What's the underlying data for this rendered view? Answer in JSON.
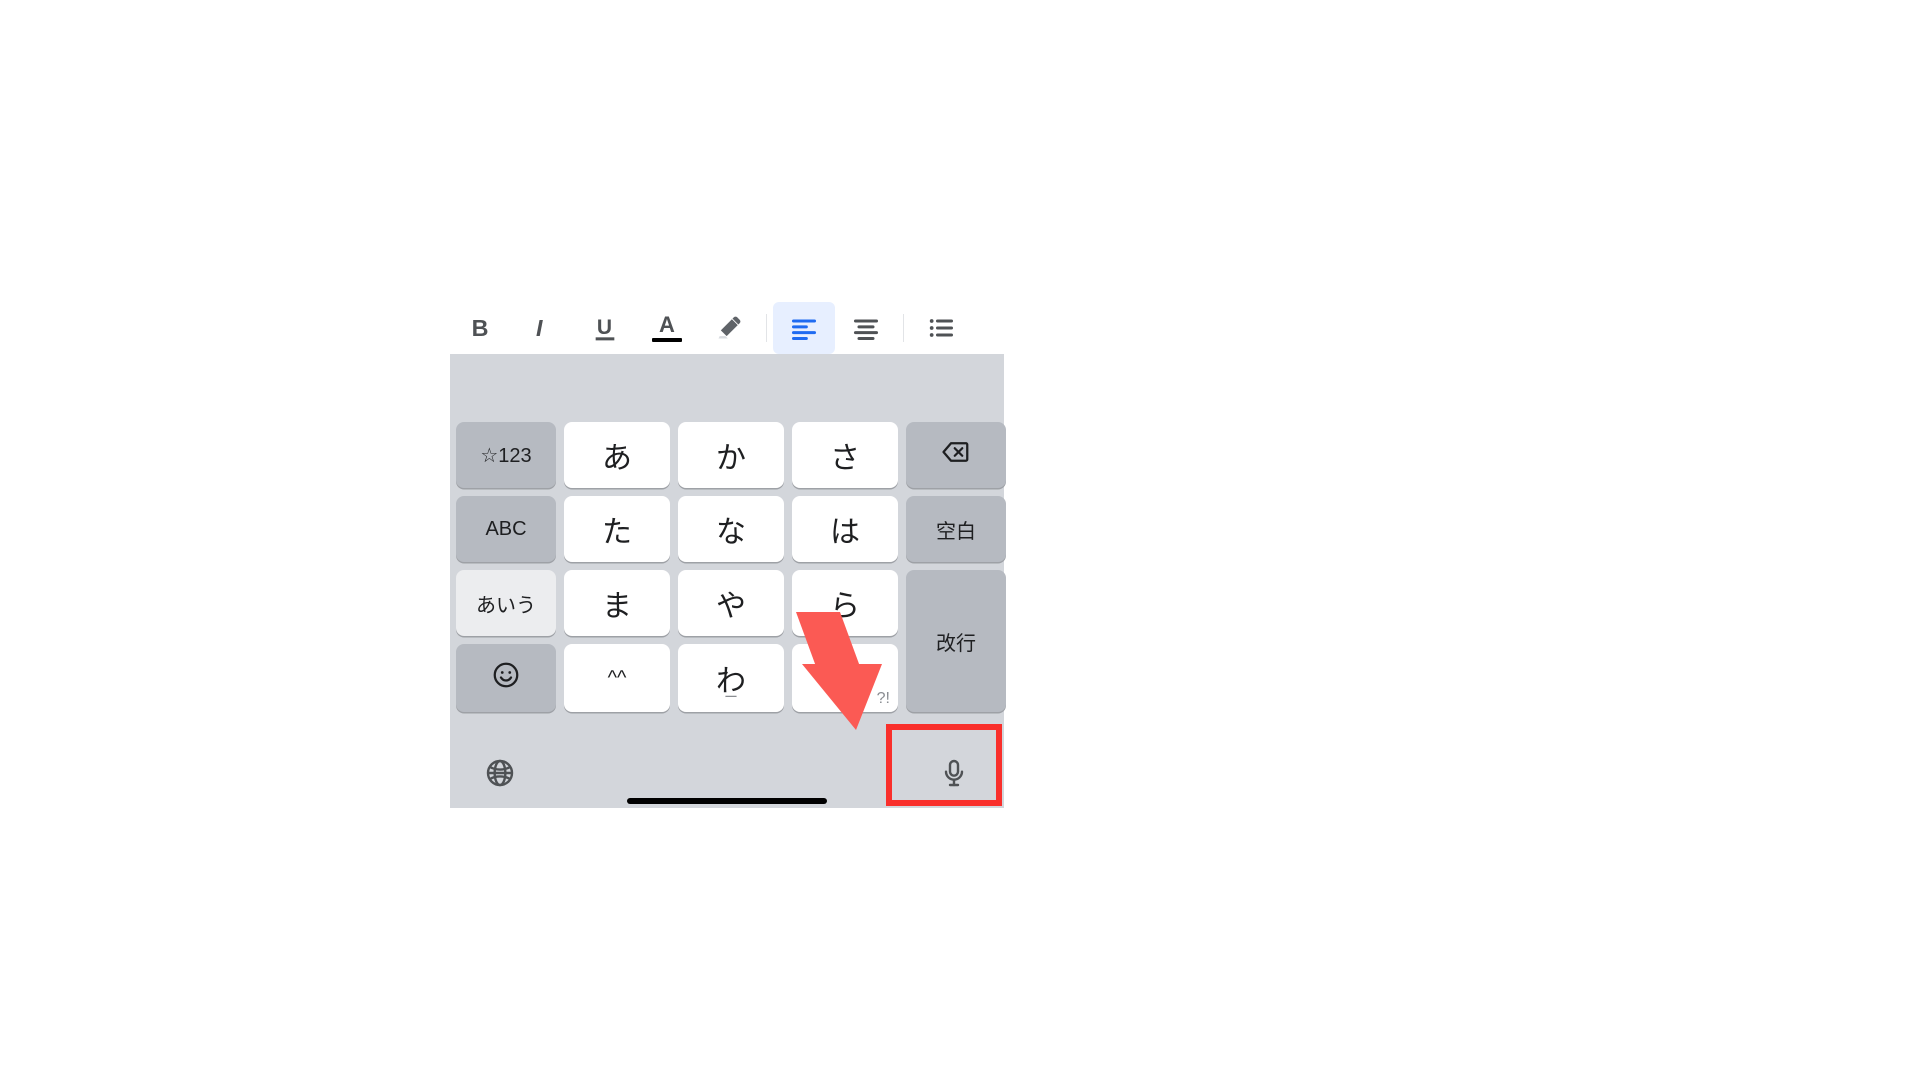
{
  "toolbar": {
    "bold": {
      "label": "B",
      "name": "bold-button"
    },
    "italic": {
      "label": "I",
      "name": "italic-button"
    },
    "underline": {
      "label": "U",
      "name": "underline-button"
    },
    "textcolor": {
      "letter": "A",
      "bar_color": "#000000",
      "name": "text-color-button"
    },
    "highlight": {
      "name": "highlight-button"
    },
    "alignleft": {
      "name": "align-left-button",
      "active": true
    },
    "aligncenter": {
      "name": "align-center-button"
    },
    "bulletlist": {
      "name": "bullet-list-button"
    }
  },
  "keyboard": {
    "row1_left": "☆123",
    "row1_k1": "あ",
    "row1_k2": "か",
    "row1_k3": "さ",
    "row1_right_icon": "delete-icon",
    "row2_left": "ABC",
    "row2_k1": "た",
    "row2_k2": "な",
    "row2_k3": "は",
    "row2_right": "空白",
    "row3_left": "あいう",
    "row3_k1": "ま",
    "row3_k2": "や",
    "row3_k3": "ら",
    "row4_left_icon": "emoji-icon",
    "row4_k1": "^^",
    "row4_k2": "わ",
    "row4_k2_sub": "ー",
    "row4_k3": "、",
    "row4_k3_corner": "?!",
    "return_label": "改行",
    "bottom_left_icon": "globe-icon",
    "bottom_right_icon": "microphone-icon"
  },
  "annotation": {
    "color": "#f92f2b",
    "target": "microphone-button"
  }
}
